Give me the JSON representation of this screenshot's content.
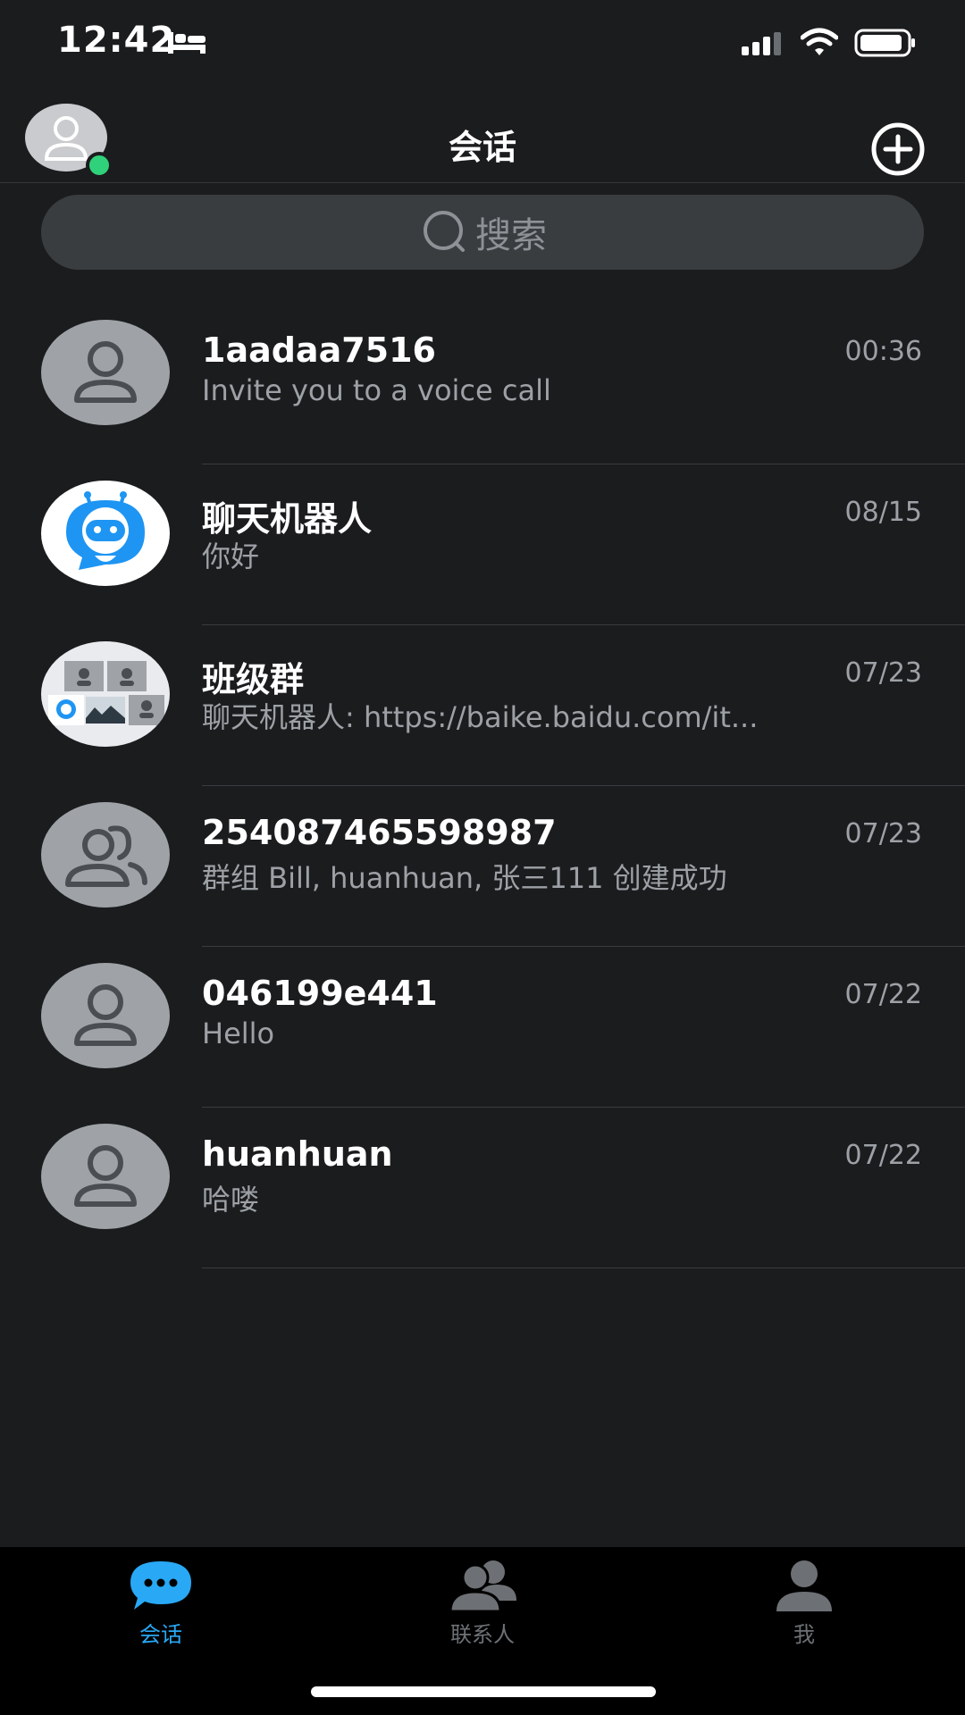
{
  "status_bar": {
    "time": "12:42",
    "icons": [
      "sleep-icon",
      "signal-icon",
      "wifi-icon",
      "battery-icon"
    ]
  },
  "header": {
    "title": "会话",
    "left_icon": "avatar-icon",
    "right_icon": "add-circle-icon",
    "online_color": "#2fd27a"
  },
  "search": {
    "placeholder": "搜索",
    "icon": "search-icon"
  },
  "conversations": [
    {
      "name": "1aadaa7516",
      "message": "Invite you to a voice call",
      "time": "00:36",
      "avatar": "person-icon"
    },
    {
      "name": "聊天机器人",
      "message": "你好",
      "time": "08/15",
      "avatar": "robot-icon"
    },
    {
      "name": "班级群",
      "message": "聊天机器人: https://baike.baidu.com/it...",
      "time": "07/23",
      "avatar": "group-collage-icon"
    },
    {
      "name": "254087465598987",
      "message": "群组 Bill, huanhuan, 张三111 创建成功",
      "time": "07/23",
      "avatar": "group-icon"
    },
    {
      "name": "046199e441",
      "message": "Hello",
      "time": "07/22",
      "avatar": "person-icon"
    },
    {
      "name": "huanhuan",
      "message": "哈喽",
      "time": "07/22",
      "avatar": "person-icon"
    }
  ],
  "tab_bar": {
    "tabs": [
      {
        "label": "会话",
        "icon": "chat-bubble-icon",
        "active": true
      },
      {
        "label": "联系人",
        "icon": "contacts-icon",
        "active": false
      },
      {
        "label": "我",
        "icon": "me-icon",
        "active": false
      }
    ],
    "active_color": "#29a8f5",
    "inactive_color": "#6d7175"
  }
}
